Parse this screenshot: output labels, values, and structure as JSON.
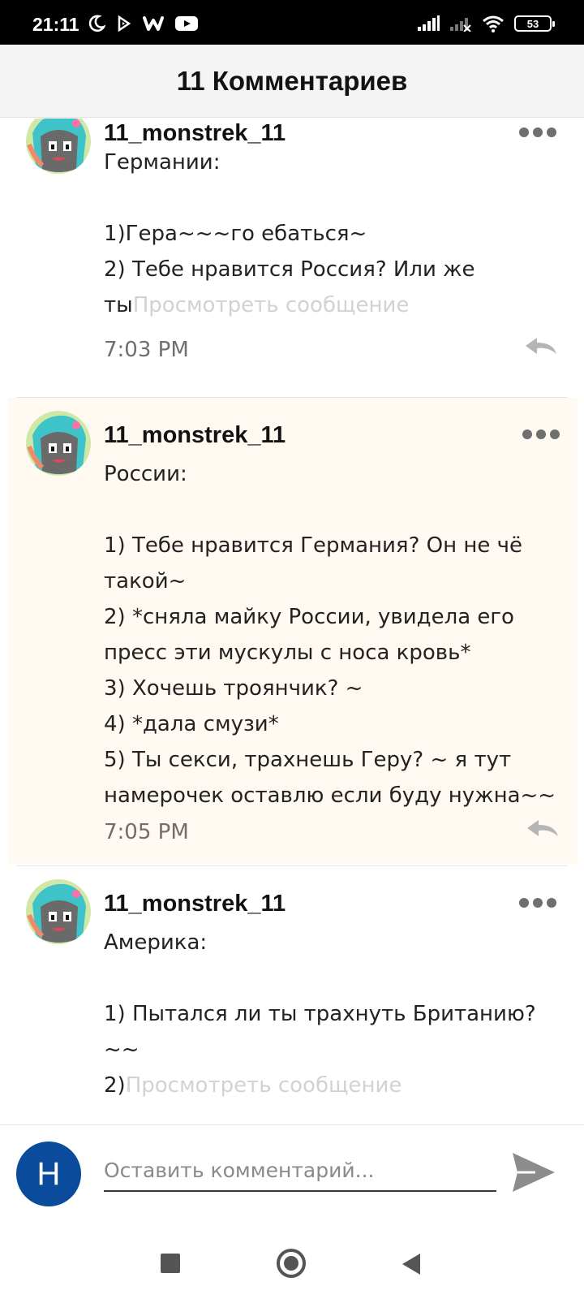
{
  "status_bar": {
    "time": "21:11",
    "battery": "53"
  },
  "header": {
    "title": "11 Комментариев"
  },
  "comments": [
    {
      "username": "11_monstrek_11",
      "text": "Германии:\n\n1)Гера~~~го ебаться~\n2) Тебе нравится Россия? Или же ты",
      "view_more": "Просмотреть сообщение",
      "time": "7:03 PM"
    },
    {
      "username": "11_monstrek_11",
      "text": "России:\n\n1) Тебе нравится Германия? Он не чё такой~\n2) *сняла майку России, увидела его пресс эти мускулы с носа кровь*\n3) Хочешь троянчик? ~\n4) *дала смузи*\n5) Ты секси, трахнешь Геру? ~ я тут намерочек оставлю если буду нужна~~",
      "view_more": "",
      "time": "7:05 PM"
    },
    {
      "username": "11_monstrek_11",
      "text": "Америка:\n\n1) Пытался ли ты трахнуть Британию? ~~\n2)",
      "view_more": "Просмотреть сообщение",
      "time": ""
    }
  ],
  "input": {
    "user_initial": "H",
    "placeholder": "Оставить комментарий..."
  },
  "colors": {
    "highlight_background": "#fff9f2",
    "user_avatar": "#0a4b9c",
    "view_more_text": "#d2d2d2"
  }
}
